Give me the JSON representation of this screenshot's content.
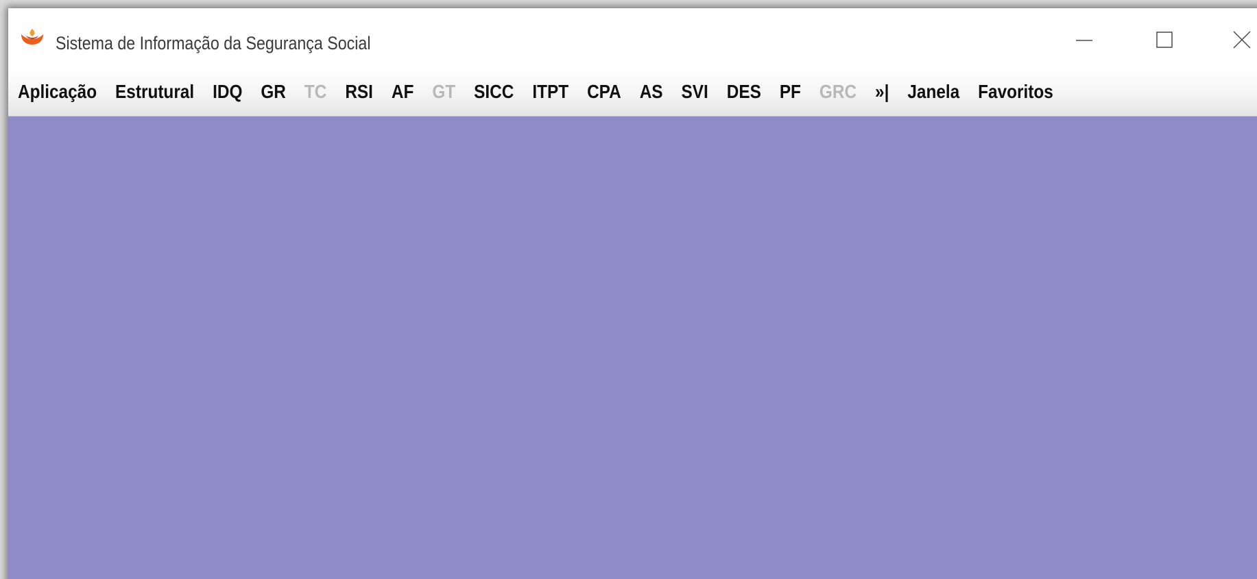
{
  "window": {
    "title": "Sistema de Informação da Segurança Social",
    "icon": "flame-icon",
    "controls": [
      "minimize-icon",
      "maximize-icon",
      "close-icon"
    ]
  },
  "menu": {
    "items": [
      {
        "label": "Aplicação",
        "enabled": true
      },
      {
        "label": "Estrutural",
        "enabled": true
      },
      {
        "label": "IDQ",
        "enabled": true
      },
      {
        "label": "GR",
        "enabled": true
      },
      {
        "label": "TC",
        "enabled": false
      },
      {
        "label": "RSI",
        "enabled": true
      },
      {
        "label": "AF",
        "enabled": true
      },
      {
        "label": "GT",
        "enabled": false
      },
      {
        "label": "SICC",
        "enabled": true
      },
      {
        "label": "ITPT",
        "enabled": true
      },
      {
        "label": "CPA",
        "enabled": true
      },
      {
        "label": "AS",
        "enabled": true
      },
      {
        "label": "SVI",
        "enabled": true
      },
      {
        "label": "DES",
        "enabled": true
      },
      {
        "label": "PF",
        "enabled": true
      },
      {
        "label": "GRC",
        "enabled": false
      },
      {
        "label": "»|",
        "enabled": true
      },
      {
        "label": "Janela",
        "enabled": true
      },
      {
        "label": "Favoritos",
        "enabled": true
      }
    ]
  },
  "colors": {
    "desktop": "#8e8cc6",
    "menu_text": "#101010",
    "menu_disabled": "#b8b8b8",
    "icon_orange": "#e8601c"
  }
}
